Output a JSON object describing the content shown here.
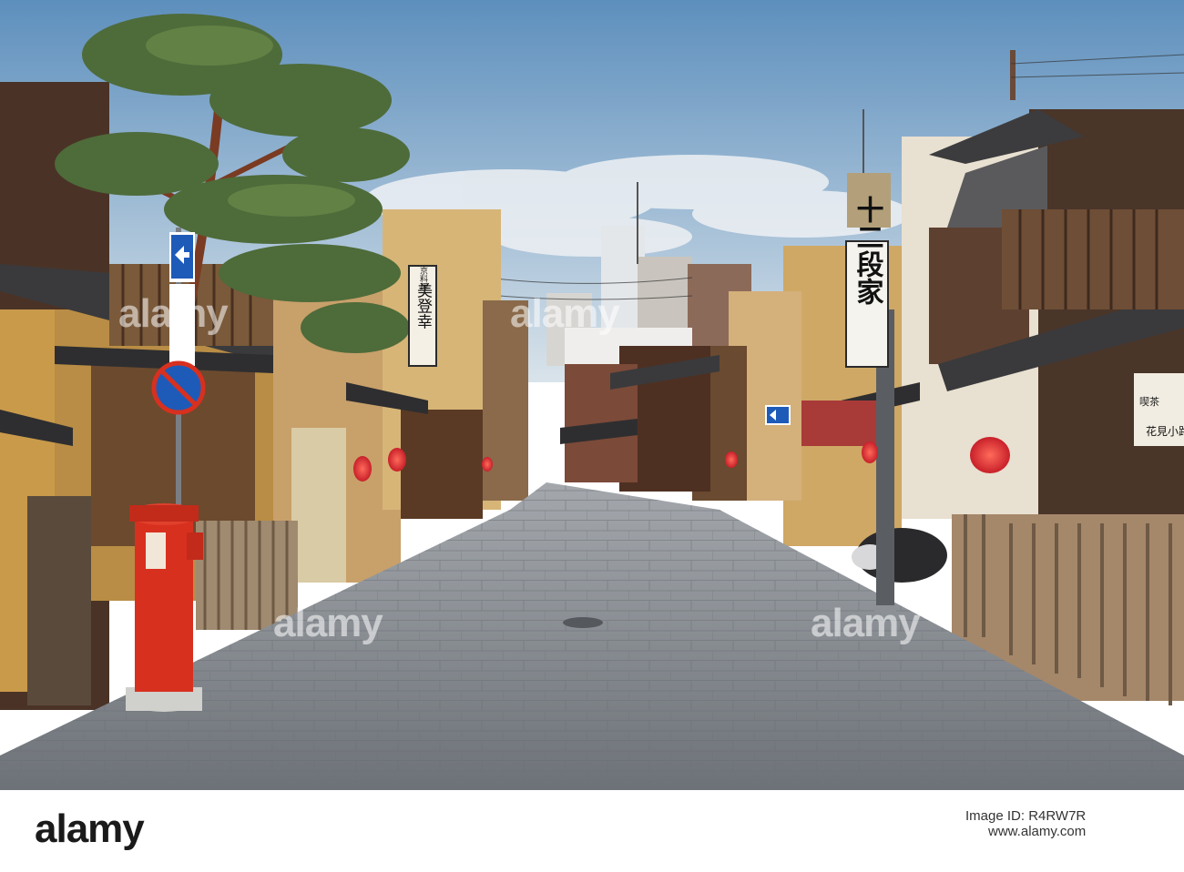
{
  "photo": {
    "scene": "street",
    "colors": {
      "sky_top": "#5d8fbd",
      "sky_bottom": "#d9e3ea",
      "pavement": "#8a8f96",
      "post_box": "#d8301f",
      "lantern": "#c8202a",
      "wood": "#5a3a25",
      "plaster": "#c99a4a"
    },
    "signs": {
      "restaurant_small": "京料理",
      "restaurant_name": "美登幸",
      "restaurant_right": "十二段家",
      "cafe_small": "喫茶",
      "cafe_name": "花見小路"
    }
  },
  "watermark": {
    "text": "alamy"
  },
  "footer": {
    "logo": "alamy",
    "image_id": "Image ID: R4RW7R",
    "url": "www.alamy.com"
  }
}
